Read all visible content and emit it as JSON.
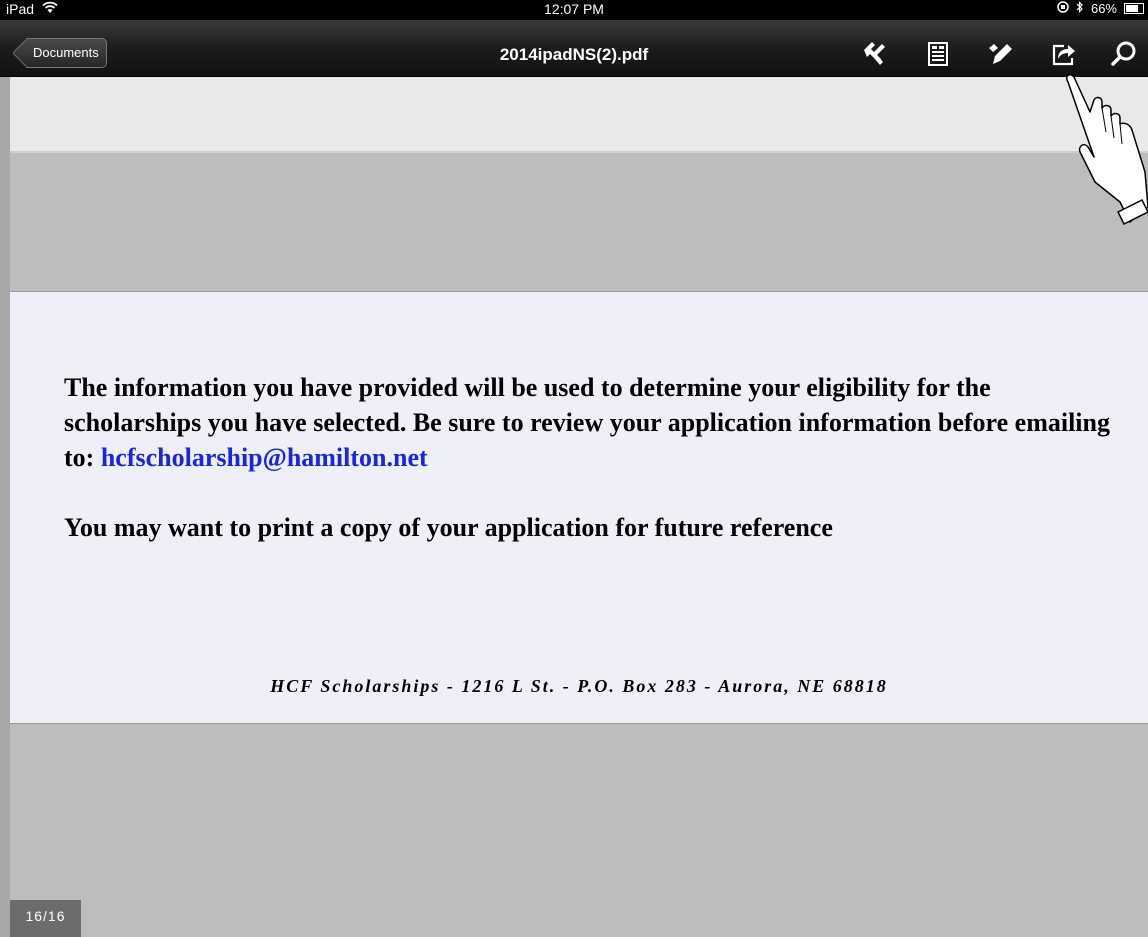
{
  "status_bar": {
    "device": "iPad",
    "time": "12:07 PM",
    "battery": "66%",
    "battery_level": 0.66
  },
  "nav": {
    "back_label": "Documents",
    "title": "2014ipadNS(2).pdf",
    "tools": [
      "tools-icon",
      "thumbnails-icon",
      "annotate-icon",
      "share-icon",
      "search-icon"
    ]
  },
  "document": {
    "paragraph1_text": "The information you have provided will be used to determine your eligibility for the scholarships you have selected. Be sure to review your application information before emailing to: ",
    "email": "hcfscholarship@hamilton.net",
    "paragraph2": "You may want to print a copy of your application for future reference",
    "footer": "HCF Scholarships - 1216 L St. - P.O. Box 283 - Aurora, NE 68818"
  },
  "page_indicator": "16/16",
  "colors": {
    "link": "#1b24e0",
    "page_background": "#efeff8",
    "viewer_background": "#bdbdbd"
  }
}
